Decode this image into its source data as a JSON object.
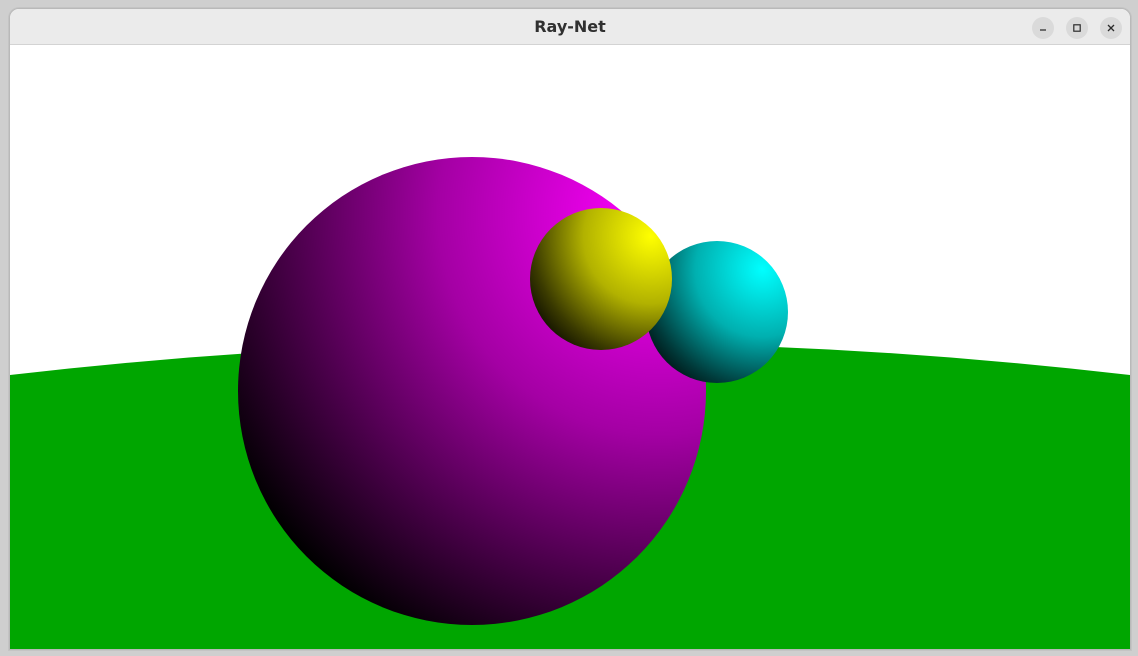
{
  "window": {
    "title": "Ray-Net",
    "controls": {
      "minimize_icon": "minimize-icon",
      "maximize_icon": "maximize-icon",
      "close_icon": "close-icon"
    }
  },
  "scene": {
    "background_color": "#ffffff",
    "ground_color": "#00a600",
    "objects": [
      {
        "name": "large-sphere",
        "color": "#ff00ff"
      },
      {
        "name": "small-sphere-yellow",
        "color": "#ffff00"
      },
      {
        "name": "small-sphere-cyan",
        "color": "#00ffff"
      }
    ]
  }
}
